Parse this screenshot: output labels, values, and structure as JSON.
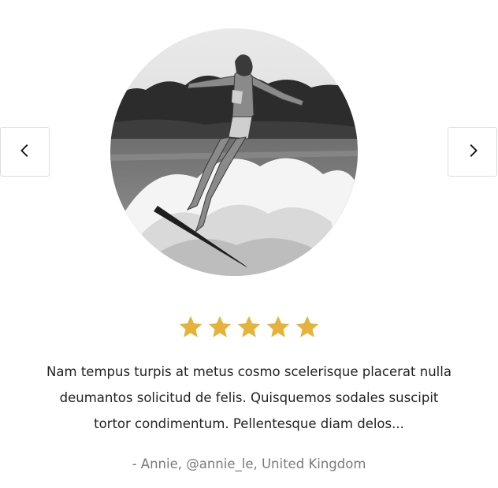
{
  "testimonial": {
    "rating": 5,
    "rating_max": 5,
    "star_color": "#E5B33A",
    "quote_lines": [
      "Nam tempus turpis at metus cosmo scelerisque placerat nulla",
      "deumantos solicitud de felis. Quisquemos sodales suscipit",
      "tortor condimentum. Pellentesque diam delos..."
    ],
    "author": "- Annie, @annie_le, United Kingdom"
  },
  "nav": {
    "prev_icon": "chevron-left-icon",
    "next_icon": "chevron-right-icon"
  }
}
